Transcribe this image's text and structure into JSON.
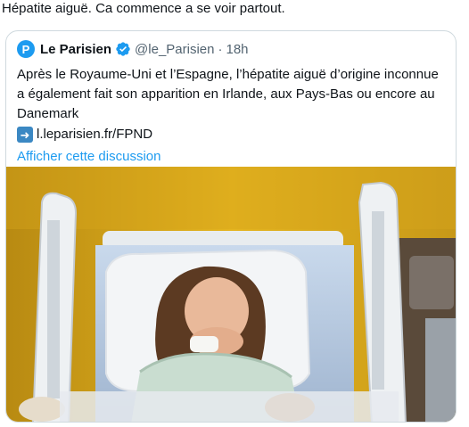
{
  "tweet": {
    "text": "Hépatite aiguë. Ca commence a se voir partout."
  },
  "quote": {
    "avatar_letter": "P",
    "display_name": "Le Parisien",
    "handle": "@le_Parisien",
    "separator": "·",
    "time": "18h",
    "body": "Après le Royaume-Uni et l’Espagne, l’hépatite aiguë d’origine inconnue a également fait son apparition en Irlande, aux Pays-Bas ou encore au Danemark",
    "link_icon": "right-arrow-icon",
    "link_text": "l.leparisien.fr/FPND",
    "show_thread": "Afficher cette discussion"
  },
  "colors": {
    "accent": "#1d9bf0",
    "border": "#cfd9de",
    "secondary_text": "#536471"
  }
}
